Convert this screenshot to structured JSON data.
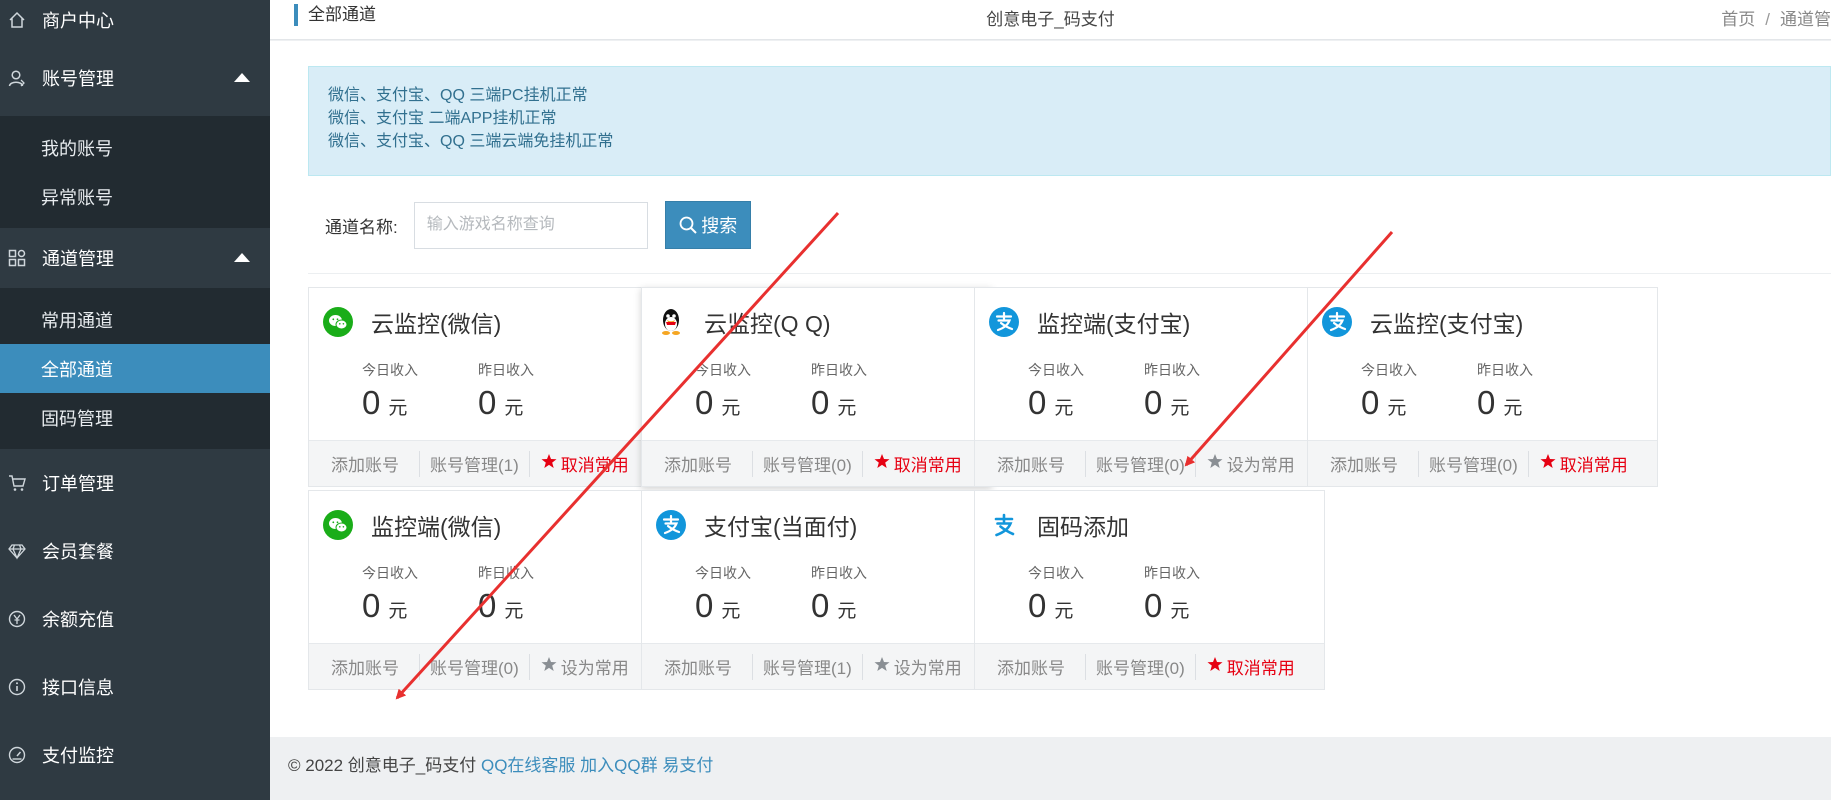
{
  "sidebar": {
    "merchant_center": "商户中心",
    "account_mgmt": "账号管理",
    "my_accounts": "我的账号",
    "abnormal_accounts": "异常账号",
    "channel_mgmt": "通道管理",
    "common_channels": "常用通道",
    "all_channels": "全部通道",
    "fixed_code_mgmt": "固码管理",
    "order_mgmt": "订单管理",
    "member_plans": "会员套餐",
    "balance_recharge": "余额充值",
    "api_info": "接口信息",
    "payment_monitor": "支付监控"
  },
  "topbar": {
    "section": "全部通道",
    "site_title": "创意电子_码支付",
    "crumb_home": "首页",
    "crumb_sep": "/",
    "crumb_current": "通道管"
  },
  "alert": {
    "line1": "微信、支付宝、QQ 三端PC挂机正常",
    "line2": "微信、支付宝 二端APP挂机正常",
    "line3": "微信、支付宝、QQ 三端云端免挂机正常"
  },
  "search": {
    "label": "通道名称:",
    "placeholder": "输入游戏名称查询",
    "button": "搜索"
  },
  "cards": [
    {
      "icon": "wechat-icon",
      "title": "云监控(微信)",
      "today_label": "今日收入",
      "today_value": "0",
      "yesterday_label": "昨日收入",
      "yesterday_value": "0",
      "unit": "元",
      "add": "添加账号",
      "manage": "账号管理(1)",
      "fav": "取消常用",
      "fav_on": true
    },
    {
      "icon": "qq-icon",
      "title": "云监控(Q Q)",
      "today_label": "今日收入",
      "today_value": "0",
      "yesterday_label": "昨日收入",
      "yesterday_value": "0",
      "unit": "元",
      "add": "添加账号",
      "manage": "账号管理(0)",
      "fav": "取消常用",
      "fav_on": true
    },
    {
      "icon": "alipay-icon",
      "title": "监控端(支付宝)",
      "today_label": "今日收入",
      "today_value": "0",
      "yesterday_label": "昨日收入",
      "yesterday_value": "0",
      "unit": "元",
      "add": "添加账号",
      "manage": "账号管理(0)",
      "fav": "设为常用",
      "fav_on": false
    },
    {
      "icon": "alipay-icon",
      "title": "云监控(支付宝)",
      "today_label": "今日收入",
      "today_value": "0",
      "yesterday_label": "昨日收入",
      "yesterday_value": "0",
      "unit": "元",
      "add": "添加账号",
      "manage": "账号管理(0)",
      "fav": "取消常用",
      "fav_on": true
    },
    {
      "icon": "wechat-icon",
      "title": "监控端(微信)",
      "today_label": "今日收入",
      "today_value": "0",
      "yesterday_label": "昨日收入",
      "yesterday_value": "0",
      "unit": "元",
      "add": "添加账号",
      "manage": "账号管理(0)",
      "fav": "设为常用",
      "fav_on": false
    },
    {
      "icon": "alipay-icon",
      "title": "支付宝(当面付)",
      "today_label": "今日收入",
      "today_value": "0",
      "yesterday_label": "昨日收入",
      "yesterday_value": "0",
      "unit": "元",
      "add": "添加账号",
      "manage": "账号管理(1)",
      "fav": "设为常用",
      "fav_on": false
    },
    {
      "icon": "alipay-plain-icon",
      "title": "固码添加",
      "today_label": "今日收入",
      "today_value": "0",
      "yesterday_label": "昨日收入",
      "yesterday_value": "0",
      "unit": "元",
      "add": "添加账号",
      "manage": "账号管理(0)",
      "fav": "取消常用",
      "fav_on": true
    }
  ],
  "footer": {
    "copyright": "© 2022 创意电子_码支付",
    "link_service": "QQ在线客服",
    "link_group": "加入QQ群",
    "link_epay": "易支付"
  },
  "colors": {
    "sidebar_bg": "#2f3a42",
    "submenu_bg": "#222b31",
    "active": "#3c8dbc",
    "alert_bg": "#d9edf7",
    "alert_text": "#31708f",
    "fav_on": "#e60012",
    "wechat": "#1aad19",
    "alipay": "#1296db",
    "annotation_arrow": "#e8302f"
  }
}
